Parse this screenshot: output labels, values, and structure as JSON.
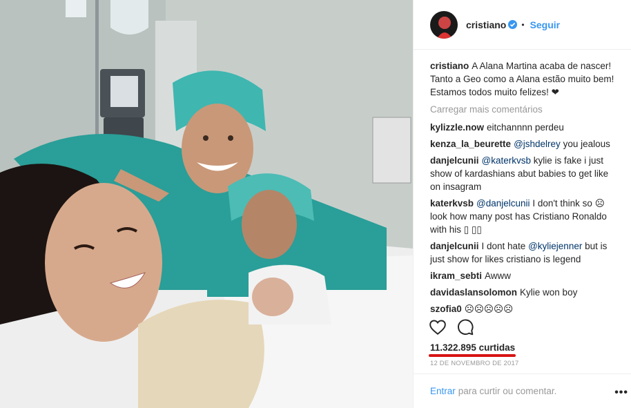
{
  "post": {
    "username": "cristiano",
    "follow_label": "Seguir",
    "separator": "•",
    "caption_user": "cristiano",
    "caption_text": "A Alana Martina acaba de nascer! Tanto a Geo como a Alana estão muito bem! Estamos todos muito felizes! ❤"
  },
  "load_more": "Carregar mais comentários",
  "comments": [
    {
      "user": "kylizzle.now",
      "text": "eitchannnn perdeu"
    },
    {
      "user": "kenza_la_beurette",
      "mention": "@jshdelrey",
      "text": "you jealous"
    },
    {
      "user": "danjelcunii",
      "mention": "@katerkvsb",
      "text": "kylie is fake i just show of kardashians abut babies to get like on insagram"
    },
    {
      "user": "katerkvsb",
      "mention": "@danjelcunii",
      "text": "I don't think so ☹ look how many post has Cristiano Ronaldo with his ▯ ▯▯"
    },
    {
      "user": "danjelcunii",
      "text_before": "I dont hate",
      "mention": "@kyliejenner",
      "text": "but is just show for likes cristiano is legend"
    },
    {
      "user": "ikram_sebti",
      "text": "Awww"
    },
    {
      "user": "davidaslansolomon",
      "text": "Kylie won boy"
    },
    {
      "user": "szofia0",
      "text": "☹☹☹☹☹"
    }
  ],
  "likes_text": "11.322.895 curtidas",
  "date_text": "12 DE NOVEMBRO DE 2017",
  "footer": {
    "login_label": "Entrar",
    "rest_text": "para curtir ou comentar.",
    "more_label": "•••"
  },
  "icons": {
    "like": "heart-icon",
    "comment": "comment-bubble-icon",
    "verified": "verified-badge-icon"
  },
  "colors": {
    "accent_blue": "#3897f0",
    "mention_blue": "#003569",
    "muted_grey": "#999999",
    "underline_red": "#d71313",
    "scrubs_teal": "#2fa6a0"
  }
}
